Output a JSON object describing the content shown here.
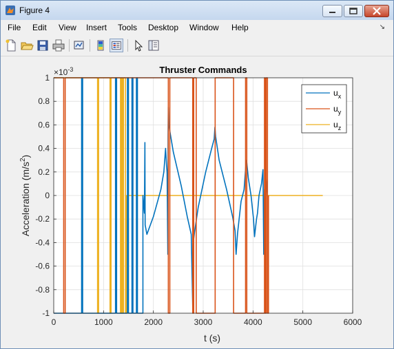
{
  "window": {
    "title": "Figure 4"
  },
  "menu": {
    "items": [
      "File",
      "Edit",
      "View",
      "Insert",
      "Tools",
      "Desktop",
      "Window",
      "Help"
    ],
    "arrow": "↘"
  },
  "toolbar": {
    "icons": [
      "new-figure-icon",
      "open-file-icon",
      "save-icon",
      "print-icon",
      "link-plot-icon",
      "colorbar-icon",
      "legend-icon",
      "pointer-icon",
      "property-inspector-icon"
    ]
  },
  "colors": {
    "ux": "#0072bd",
    "uy": "#d95319",
    "uz": "#edb120"
  },
  "chart_data": {
    "type": "line",
    "title": "Thruster Commands",
    "xlabel": "t (s)",
    "ylabel_main": "Acceleration (m/s",
    "ylabel_sup": "2",
    "ylabel_tail": ")",
    "exponent_base": "×10",
    "exponent_power": "-3",
    "xlim": [
      0,
      6000
    ],
    "ylim": [
      -1,
      1
    ],
    "xticks": [
      "0",
      "1000",
      "2000",
      "3000",
      "4000",
      "5000",
      "6000"
    ],
    "yticks": [
      "-1",
      "-0.8",
      "-0.6",
      "-0.4",
      "-0.2",
      "0",
      "0.2",
      "0.4",
      "0.6",
      "0.8",
      "1"
    ],
    "grid": true,
    "legend_position": "top-right",
    "legend": [
      {
        "base": "u",
        "sub": "x"
      },
      {
        "base": "u",
        "sub": "y"
      },
      {
        "base": "u",
        "sub": "z"
      }
    ],
    "series": [
      {
        "name": "ux",
        "points": [
          [
            0,
            -1
          ],
          [
            560,
            -1
          ],
          [
            560,
            1
          ],
          [
            580,
            1
          ],
          [
            580,
            -1
          ],
          [
            1240,
            -1
          ],
          [
            1240,
            1
          ],
          [
            1262,
            1
          ],
          [
            1262,
            -1
          ],
          [
            1480,
            -1
          ],
          [
            1480,
            1
          ],
          [
            1500,
            1
          ],
          [
            1500,
            -1
          ],
          [
            1570,
            -1
          ],
          [
            1570,
            1
          ],
          [
            1590,
            1
          ],
          [
            1590,
            -1
          ],
          [
            1660,
            -1
          ],
          [
            1660,
            1
          ],
          [
            1680,
            1
          ],
          [
            1680,
            -1
          ],
          [
            1790,
            -1
          ],
          [
            1790,
            0
          ],
          [
            1820,
            -0.15
          ],
          [
            1830,
            0.45
          ],
          [
            1835,
            -0.25
          ],
          [
            1870,
            -0.33
          ],
          [
            2000,
            -0.18
          ],
          [
            2150,
            0.05
          ],
          [
            2210,
            0.2
          ],
          [
            2245,
            0.4
          ],
          [
            2265,
            0.25
          ],
          [
            2275,
            0.2
          ],
          [
            2290,
            -0.5
          ],
          [
            2295,
            0.5
          ],
          [
            2300,
            0.75
          ],
          [
            2310,
            0.6
          ],
          [
            2400,
            0.37
          ],
          [
            2560,
            0.08
          ],
          [
            2680,
            -0.18
          ],
          [
            2760,
            -0.33
          ],
          [
            2790,
            -0.95
          ],
          [
            2800,
            -0.4
          ],
          [
            2830,
            -0.3
          ],
          [
            2900,
            -0.1
          ],
          [
            3050,
            0.2
          ],
          [
            3170,
            0.4
          ],
          [
            3220,
            0.48
          ],
          [
            3235,
            0.58
          ],
          [
            3250,
            0.5
          ],
          [
            3320,
            0.3
          ],
          [
            3470,
            0.05
          ],
          [
            3590,
            -0.18
          ],
          [
            3640,
            -0.3
          ],
          [
            3660,
            -0.5
          ],
          [
            3690,
            -0.32
          ],
          [
            3760,
            -0.05
          ],
          [
            3820,
            0.05
          ],
          [
            3860,
            0.28
          ],
          [
            3870,
            0.3
          ],
          [
            3905,
            0.15
          ],
          [
            3960,
            0.0
          ],
          [
            4010,
            -0.2
          ],
          [
            4030,
            -0.35
          ],
          [
            4070,
            -0.2
          ],
          [
            4090,
            -0.15
          ],
          [
            4120,
            0.0
          ],
          [
            4170,
            0.1
          ],
          [
            4200,
            0.22
          ],
          [
            4215,
            -0.5
          ],
          [
            4230,
            0.05
          ],
          [
            4240,
            -0.05
          ],
          [
            4260,
            0.15
          ],
          [
            4280,
            0.05
          ],
          [
            4290,
            0.0
          ]
        ]
      },
      {
        "name": "uy",
        "points": [
          [
            0,
            1
          ],
          [
            200,
            1
          ],
          [
            200,
            -1
          ],
          [
            230,
            -1
          ],
          [
            230,
            1
          ],
          [
            2300,
            1
          ],
          [
            2300,
            -1
          ],
          [
            2330,
            -1
          ],
          [
            2330,
            1
          ],
          [
            2790,
            1
          ],
          [
            2790,
            -1
          ],
          [
            2810,
            -1
          ],
          [
            2810,
            1
          ],
          [
            2860,
            1
          ],
          [
            2860,
            -1
          ],
          [
            3240,
            -1
          ],
          [
            3240,
            1
          ],
          [
            3610,
            1
          ],
          [
            3610,
            -1
          ],
          [
            3850,
            -1
          ],
          [
            3850,
            1
          ],
          [
            3875,
            1
          ],
          [
            3875,
            -1
          ],
          [
            4230,
            -1
          ],
          [
            4230,
            1
          ],
          [
            4245,
            1
          ],
          [
            4245,
            -1
          ],
          [
            4265,
            -1
          ],
          [
            4265,
            1
          ],
          [
            4290,
            1
          ],
          [
            4290,
            -1
          ],
          [
            4310,
            -1
          ],
          [
            4310,
            0
          ]
        ]
      },
      {
        "name": "uz",
        "points": [
          [
            0,
            1
          ],
          [
            880,
            1
          ],
          [
            880,
            -1
          ],
          [
            900,
            -1
          ],
          [
            900,
            1
          ],
          [
            1130,
            1
          ],
          [
            1130,
            -1
          ],
          [
            1150,
            -1
          ],
          [
            1150,
            1
          ],
          [
            1340,
            1
          ],
          [
            1340,
            -1
          ],
          [
            1360,
            -1
          ],
          [
            1360,
            1
          ],
          [
            1380,
            1
          ],
          [
            1380,
            -1
          ],
          [
            1400,
            -1
          ],
          [
            1400,
            1
          ],
          [
            1440,
            1
          ],
          [
            1440,
            -1
          ],
          [
            1460,
            -1
          ],
          [
            1460,
            0
          ],
          [
            5400,
            0
          ]
        ]
      }
    ]
  }
}
